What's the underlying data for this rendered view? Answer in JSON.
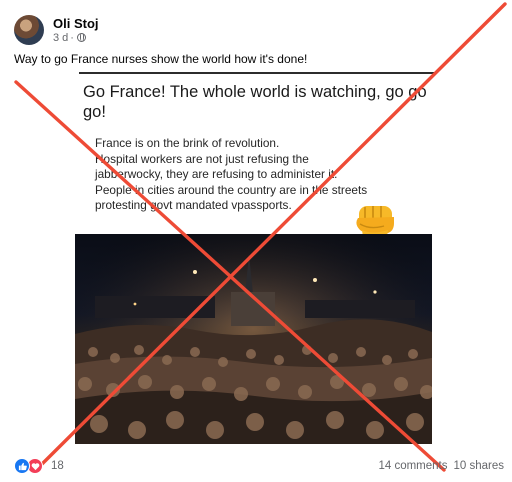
{
  "post": {
    "author": "Oli Stoj",
    "time": "3 d",
    "separator": "·",
    "caption": "Way to go France nurses show the world how it's done!"
  },
  "shared_image": {
    "title": "Go France! The whole world is watching, go go go!",
    "body_lines": [
      "France is on the brink of revolution.",
      "Hospital workers are not just refusing the",
      "jabberwocky, they are refusing to administer it.",
      "People in cities around the country are in the streets",
      "protesting govt mandated vpassports."
    ]
  },
  "footer": {
    "reaction_count": "18",
    "comments": "14 comments",
    "shares": "10 shares"
  },
  "icons": {
    "avatar": "avatar",
    "visibility": "globe-icon",
    "fist": "raised-fist-icon",
    "like": "like-icon",
    "love": "love-icon"
  },
  "colors": {
    "overlay_x": "#ee4b36",
    "like": "#1877f2",
    "love": "#f33e58",
    "fist": "#f7b928"
  }
}
